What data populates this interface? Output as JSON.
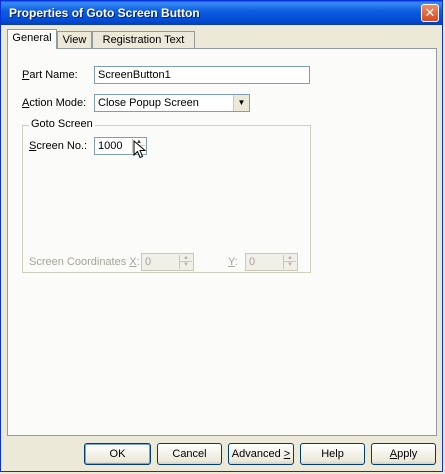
{
  "window": {
    "title": "Properties of Goto Screen Button",
    "close_glyph": "✕"
  },
  "tabs": [
    {
      "label": "General",
      "active": true
    },
    {
      "label": "View",
      "active": false
    },
    {
      "label": "Registration Text",
      "active": false
    }
  ],
  "general": {
    "part_name_label_prefix": "P",
    "part_name_label_rest": "art Name:",
    "part_name_value": "ScreenButton1",
    "action_mode_label_prefix": "A",
    "action_mode_label_rest": "ction Mode:",
    "action_mode_value": "Close Popup Screen",
    "goto_group_title": "Goto Screen",
    "screen_no_label_prefix": "S",
    "screen_no_label_u": "c",
    "screen_no_label_rest": "reen No.:",
    "screen_no_value": "1000",
    "coords_label": "Screen Coordinates",
    "coords_x_key": "X",
    "coords_x_value": "0",
    "coords_y_key": "Y",
    "coords_y_value": "0"
  },
  "buttons": {
    "ok": "OK",
    "cancel": "Cancel",
    "advanced_prefix": "Advanced ",
    "advanced_u": ">",
    "help": "Help",
    "apply_u": "A",
    "apply_rest": "pply"
  },
  "icons": {
    "dropdown": "chevron-down-icon",
    "spin_up": "spin-up-icon",
    "spin_down": "spin-down-icon",
    "close": "close-icon",
    "cursor": "mouse-pointer-icon"
  },
  "colors": {
    "titlebar": "#0149d4",
    "close_button": "#d64a20",
    "dialog_bg": "#ece9d8",
    "disabled_text": "#a6a396"
  }
}
